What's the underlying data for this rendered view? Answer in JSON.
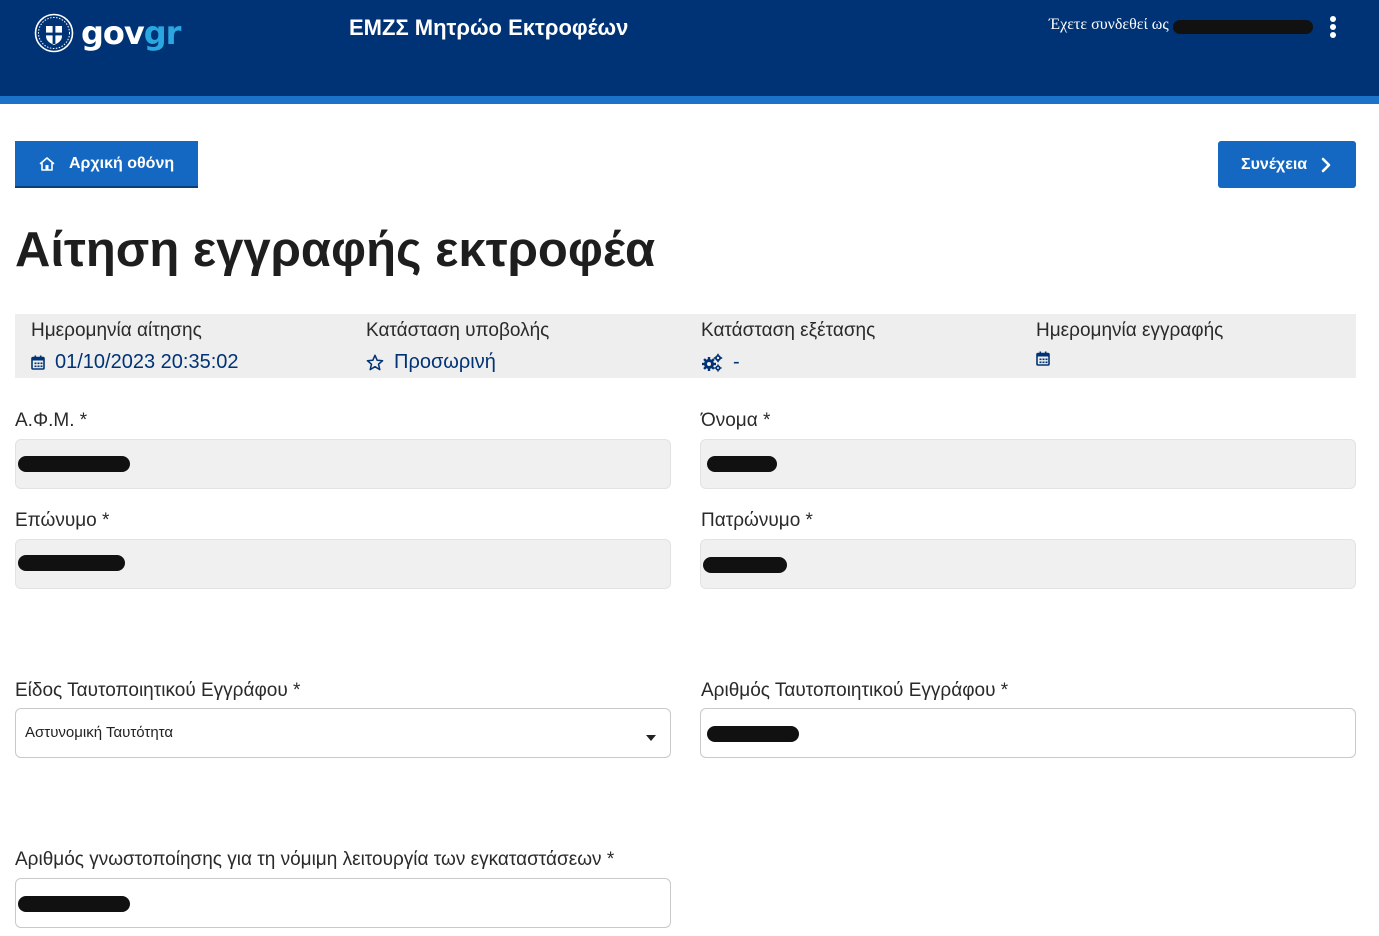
{
  "header": {
    "logo_text_main": "gov",
    "logo_text_accent": "gr",
    "app_title": "ΕΜΖΣ Μητρώο Εκτροφέων",
    "logged_in_label": "Έχετε συνδεθεί ως",
    "menu_icon": "kebab-menu-icon"
  },
  "toolbar": {
    "home_label": "Αρχική οθόνη",
    "home_icon": "home-icon",
    "next_label": "Συνέχεια",
    "next_icon": "chevron-right-icon"
  },
  "page": {
    "title": "Αίτηση εγγραφής εκτροφέα"
  },
  "info": {
    "application_date_label": "Ημερομηνία αίτησης",
    "application_date_value": "01/10/2023 20:35:02",
    "submission_status_label": "Κατάσταση υποβολής",
    "submission_status_value": "Προσωρινή",
    "review_status_label": "Κατάσταση εξέτασης",
    "review_status_value": "-",
    "registration_date_label": "Ημερομηνία εγγραφής",
    "registration_date_value": ""
  },
  "form": {
    "afm_label": "Α.Φ.Μ. *",
    "first_name_label": "Όνομα *",
    "last_name_label": "Επώνυμο *",
    "father_name_label": "Πατρώνυμο *",
    "id_type_label": "Είδος Ταυτοποιητικού Εγγράφου *",
    "id_type_value": "Αστυνομική Ταυτότητα",
    "id_number_label": "Αριθμός Ταυτοποιητικού Εγγράφου *",
    "notification_number_label": "Αριθμός γνωστοποίησης για τη νόμιμη λειτουργία των εγκαταστάσεων *"
  },
  "colors": {
    "header_bg": "#003375",
    "header_stripe": "#1a73c8",
    "primary_button": "#1468c2",
    "info_bar_bg": "#eeeeee",
    "info_value_text": "#003375"
  }
}
